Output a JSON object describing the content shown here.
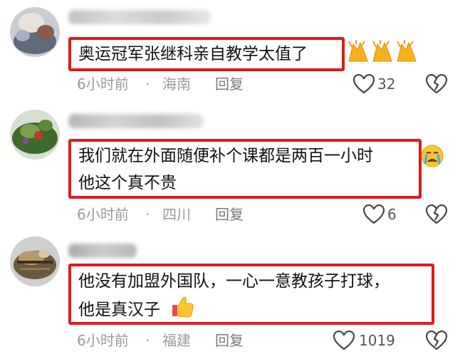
{
  "comments": [
    {
      "line1": "奥运冠军张继科亲自教学太值了",
      "line2": "",
      "emoji": "clap-hands-emoji",
      "time": "6小时前",
      "dot": "·",
      "location": "海南",
      "reply": "回复",
      "likes": "32"
    },
    {
      "line1": "我们就在外面随便补个课都是两百一小时",
      "line2": "他这个真不贵",
      "emoji": "crying-face-emoji",
      "time": "6小时前",
      "dot": "·",
      "location": "四川",
      "reply": "回复",
      "likes": "6"
    },
    {
      "line1": "他没有加盟外国队，一心一意教孩子打球，",
      "line2": "他是真汉子",
      "emoji": "thumbs-up-emoji",
      "time": "6小时前",
      "dot": "·",
      "location": "福建",
      "reply": "回复",
      "likes": "1019"
    }
  ],
  "colors": {
    "highlight_border": "#e0191e",
    "meta_text": "#9a9a9a",
    "icon_stroke": "#444444"
  }
}
